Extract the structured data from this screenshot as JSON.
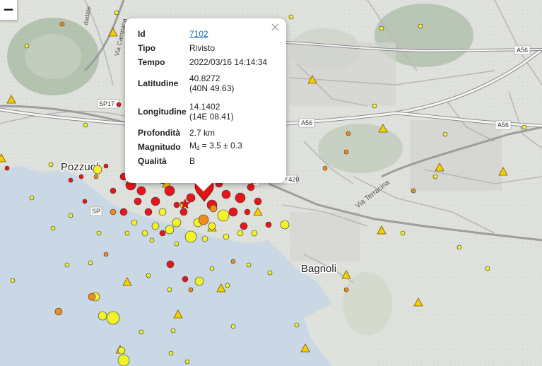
{
  "map": {
    "labels": {
      "pozzuoli": "Pozzuoli",
      "bagnoli": "Bagnoli",
      "via_terracina": "Via Terracina",
      "via_campana": "Via Campana",
      "a56_top": "A56",
      "a56_mid": "A56",
      "a56_right": "A56",
      "sp17": "SP17",
      "sp420": "SP 420",
      "sp_small": "SP",
      "sp_left": "SP",
      "dadale": "dadale"
    },
    "colors": {
      "sea": "#c9d8e4",
      "land": "#dfe2dc",
      "road": "#bfbfbf",
      "motorway": "#ffffff",
      "eq_red": "#e8161c",
      "eq_orange": "#ef8c1b",
      "eq_yellow": "#f2f22a",
      "station": "#f5d000"
    }
  },
  "controls": {
    "zoom_out": "−"
  },
  "popup": {
    "close": "×",
    "fields": {
      "id_label": "Id",
      "id_value": "7102",
      "tipo_label": "Tipo",
      "tipo_value": "Rivisto",
      "tempo_label": "Tempo",
      "tempo_value": "2022/03/16 14:14:34",
      "lat_label": "Latitudine",
      "lat_value": "40.8272",
      "lat_dms": "(40N 49.63)",
      "lon_label": "Longitudine",
      "lon_value": "14.1402",
      "lon_dms": "(14E 08.41)",
      "prof_label": "Profondità",
      "prof_value": "2.7 km",
      "mag_label": "Magnitudo",
      "mag_symbol": "M",
      "mag_sub": "d",
      "mag_value": " = 3.5 ± 0.3",
      "qual_label": "Qualità",
      "qual_value": "B"
    }
  }
}
